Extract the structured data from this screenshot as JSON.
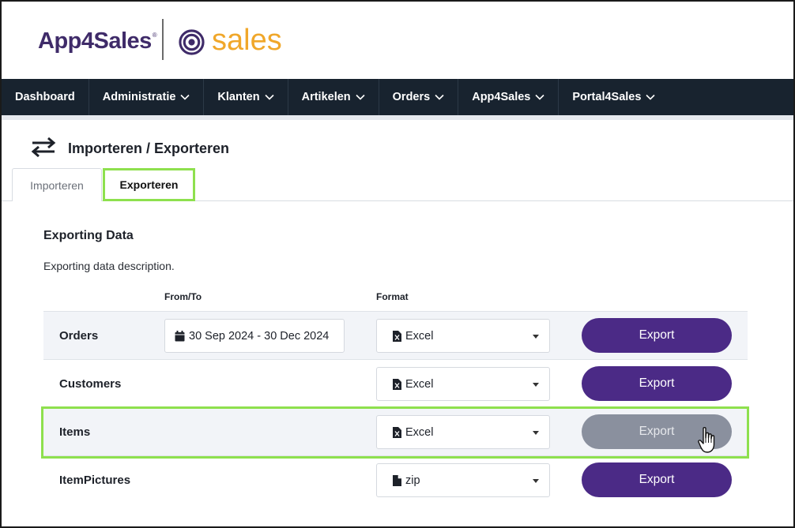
{
  "logo": {
    "brand": "App4Sales",
    "registered": "®",
    "product": "sales"
  },
  "nav": {
    "items": [
      {
        "label": "Dashboard",
        "dropdown": false
      },
      {
        "label": "Administratie",
        "dropdown": true
      },
      {
        "label": "Klanten",
        "dropdown": true
      },
      {
        "label": "Artikelen",
        "dropdown": true
      },
      {
        "label": "Orders",
        "dropdown": true
      },
      {
        "label": "App4Sales",
        "dropdown": true
      },
      {
        "label": "Portal4Sales",
        "dropdown": true
      }
    ]
  },
  "page": {
    "title": "Importeren / Exporteren",
    "icon": "swap-arrows-icon"
  },
  "tabs": {
    "import_label": "Importeren",
    "export_label": "Exporteren",
    "active": "Exporteren"
  },
  "section": {
    "title": "Exporting Data",
    "description": "Exporting data description.",
    "col_fromto": "From/To",
    "col_format": "Format"
  },
  "rows": [
    {
      "label": "Orders",
      "daterange": "30 Sep 2024 - 30 Dec 2024",
      "format": "Excel",
      "format_icon": "excel-file-icon",
      "button": "Export",
      "button_state": "enabled"
    },
    {
      "label": "Customers",
      "format": "Excel",
      "format_icon": "excel-file-icon",
      "button": "Export",
      "button_state": "enabled"
    },
    {
      "label": "Items",
      "format": "Excel",
      "format_icon": "excel-file-icon",
      "button": "Export",
      "button_state": "disabled"
    },
    {
      "label": "ItemPictures",
      "format": "zip",
      "format_icon": "file-icon",
      "button": "Export",
      "button_state": "enabled"
    }
  ],
  "colors": {
    "brand_purple": "#4b2a86",
    "logo_orange": "#f0a72a",
    "nav_bg": "#18232f",
    "highlight_green": "#8ee04e",
    "button_disabled": "#8a909e"
  }
}
